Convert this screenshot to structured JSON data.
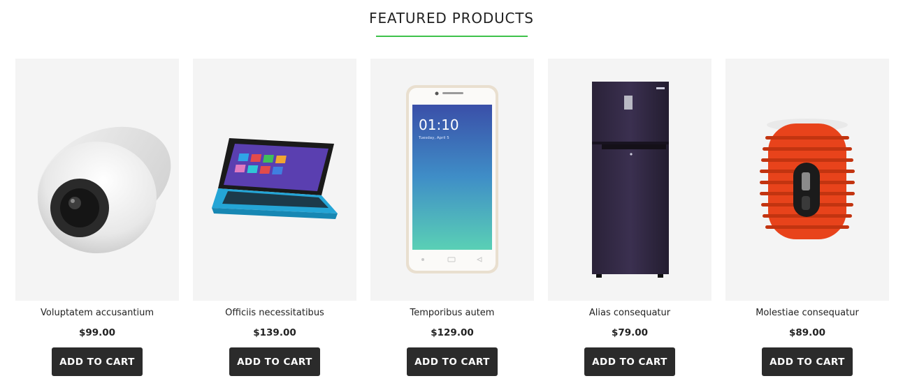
{
  "section": {
    "title": "FEATURED PRODUCTS",
    "underline_color": "#3ec24a"
  },
  "products": [
    {
      "name": "Voluptatem accusantium",
      "price": "$99.00",
      "button": "ADD TO CART",
      "image": "dome-security-camera"
    },
    {
      "name": "Officiis necessitatibus",
      "price": "$139.00",
      "button": "ADD TO CART",
      "image": "laptop"
    },
    {
      "name": "Temporibus autem",
      "price": "$129.00",
      "button": "ADD TO CART",
      "image": "smartphone"
    },
    {
      "name": "Alias consequatur",
      "price": "$79.00",
      "button": "ADD TO CART",
      "image": "refrigerator"
    },
    {
      "name": "Molestiae consequatur",
      "price": "$89.00",
      "button": "ADD TO CART",
      "image": "speaker"
    }
  ],
  "phone_screen": {
    "time": "01:10",
    "date": "Tuesday, April 5"
  }
}
